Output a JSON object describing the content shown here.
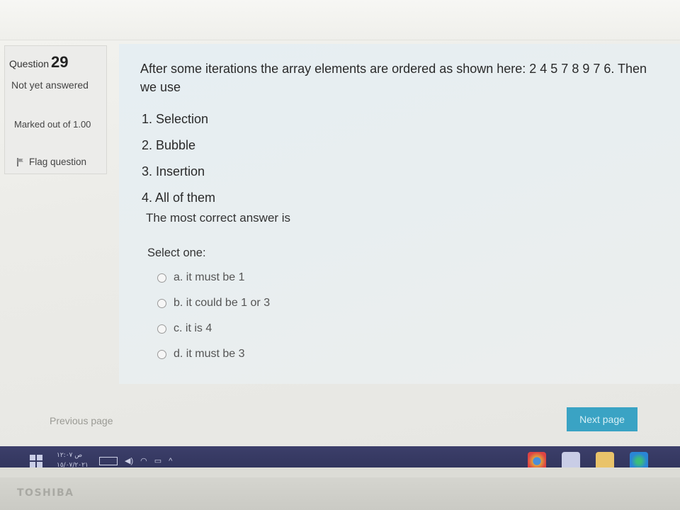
{
  "sidebar": {
    "question_word": "Question",
    "question_number": "29",
    "state": "Not yet answered",
    "marked": "Marked out of 1.00",
    "flag_label": "Flag question"
  },
  "question": {
    "text": "After some iterations the array elements are ordered as shown here: 2 4 5 7 8 9 7 6. Then we use",
    "options": [
      "1. Selection",
      "2. Bubble",
      "3. Insertion",
      "4. All of them"
    ],
    "prompt": "The most correct answer is",
    "select_label": "Select one:",
    "answers": [
      {
        "label": "a. it must be 1",
        "selected": false
      },
      {
        "label": "b. it could be 1 or 3",
        "selected": false
      },
      {
        "label": "c. it is 4",
        "selected": false
      },
      {
        "label": "d. it must be 3",
        "selected": false
      }
    ]
  },
  "navigation": {
    "previous": "Previous page",
    "next": "Next page"
  },
  "colors": {
    "next_button": "#3aa3c4",
    "taskbar": "#34375f"
  },
  "taskbar": {
    "start_icon": "windows-start-icon",
    "tray_icons": [
      "keyboard-icon",
      "speaker-icon",
      "wifi-icon",
      "battery-icon",
      "chevron-up-icon"
    ],
    "apps": [
      "chrome-icon",
      "store-icon",
      "file-explorer-icon",
      "edge-icon"
    ]
  },
  "device": {
    "brand": "TOSHIBA"
  }
}
